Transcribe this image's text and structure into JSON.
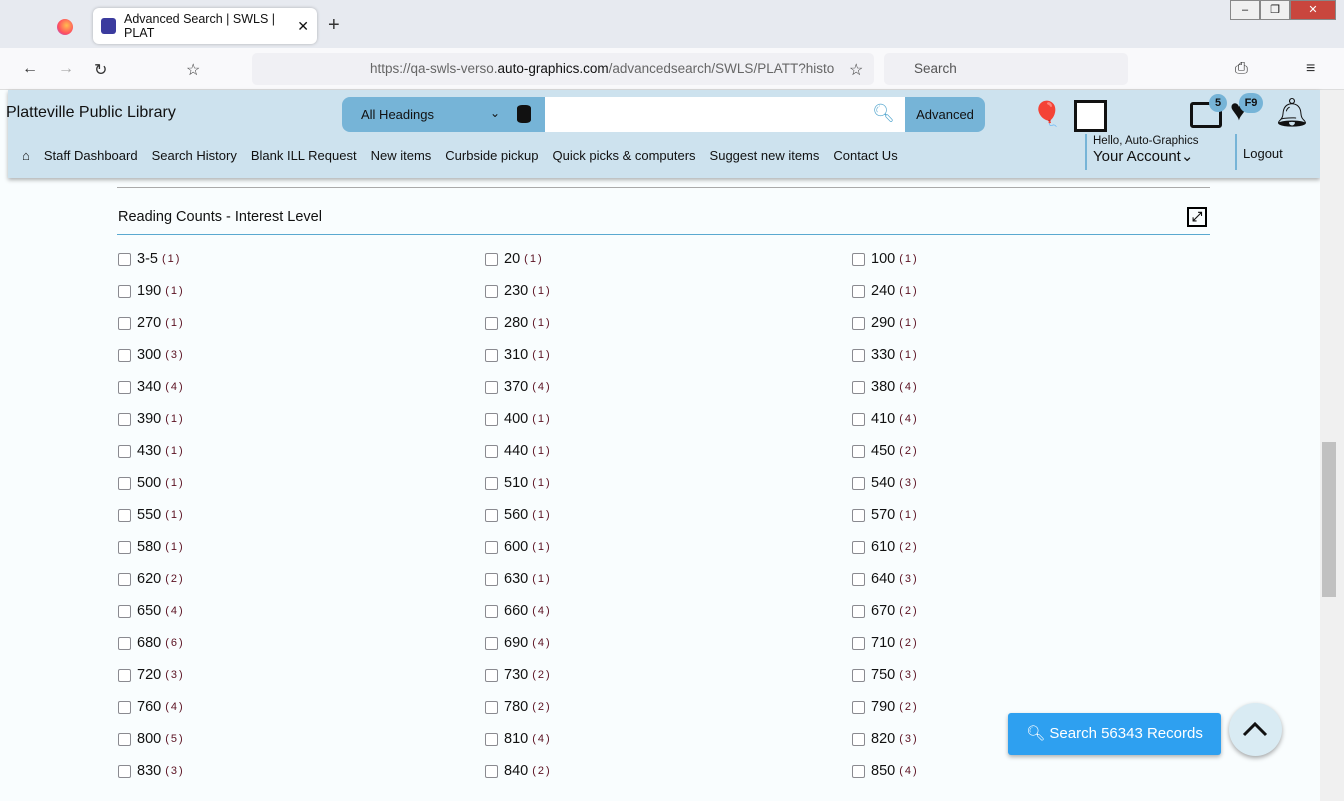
{
  "browser": {
    "tab_title": "Advanced Search | SWLS | PLAT",
    "url_host_pre": "https://qa-swls-verso.",
    "url_host": "auto-graphics.com",
    "url_path": "/advancedsearch/SWLS/PLATT?histo",
    "search_placeholder": "Search"
  },
  "header": {
    "library_name": "Platteville Public Library",
    "search_scope": "All Headings",
    "search_value": "",
    "advanced_label": "Advanced",
    "list_badge": "5",
    "favorites_badge": "F9",
    "greeting": "Hello, Auto-Graphics",
    "account_label": "Your Account",
    "logout_label": "Logout"
  },
  "menu": [
    "Staff Dashboard",
    "Search History",
    "Blank ILL Request",
    "New items",
    "Curbside pickup",
    "Quick picks & computers",
    "Suggest new items",
    "Contact Us"
  ],
  "facet": {
    "title": "Reading Counts - Interest Level",
    "items": [
      [
        "3-5",
        "1"
      ],
      [
        "20",
        "1"
      ],
      [
        "100",
        "1"
      ],
      [
        "190",
        "1"
      ],
      [
        "230",
        "1"
      ],
      [
        "240",
        "1"
      ],
      [
        "270",
        "1"
      ],
      [
        "280",
        "1"
      ],
      [
        "290",
        "1"
      ],
      [
        "300",
        "3"
      ],
      [
        "310",
        "1"
      ],
      [
        "330",
        "1"
      ],
      [
        "340",
        "4"
      ],
      [
        "370",
        "4"
      ],
      [
        "380",
        "4"
      ],
      [
        "390",
        "1"
      ],
      [
        "400",
        "1"
      ],
      [
        "410",
        "4"
      ],
      [
        "430",
        "1"
      ],
      [
        "440",
        "1"
      ],
      [
        "450",
        "2"
      ],
      [
        "500",
        "1"
      ],
      [
        "510",
        "1"
      ],
      [
        "540",
        "3"
      ],
      [
        "550",
        "1"
      ],
      [
        "560",
        "1"
      ],
      [
        "570",
        "1"
      ],
      [
        "580",
        "1"
      ],
      [
        "600",
        "1"
      ],
      [
        "610",
        "2"
      ],
      [
        "620",
        "2"
      ],
      [
        "630",
        "1"
      ],
      [
        "640",
        "3"
      ],
      [
        "650",
        "4"
      ],
      [
        "660",
        "4"
      ],
      [
        "670",
        "2"
      ],
      [
        "680",
        "6"
      ],
      [
        "690",
        "4"
      ],
      [
        "710",
        "2"
      ],
      [
        "720",
        "3"
      ],
      [
        "730",
        "2"
      ],
      [
        "750",
        "3"
      ],
      [
        "760",
        "4"
      ],
      [
        "780",
        "2"
      ],
      [
        "790",
        "2"
      ],
      [
        "800",
        "5"
      ],
      [
        "810",
        "4"
      ],
      [
        "820",
        "3"
      ],
      [
        "830",
        "3"
      ],
      [
        "840",
        "2"
      ],
      [
        "850",
        "4"
      ]
    ]
  },
  "search_button": "Search 56343 Records"
}
